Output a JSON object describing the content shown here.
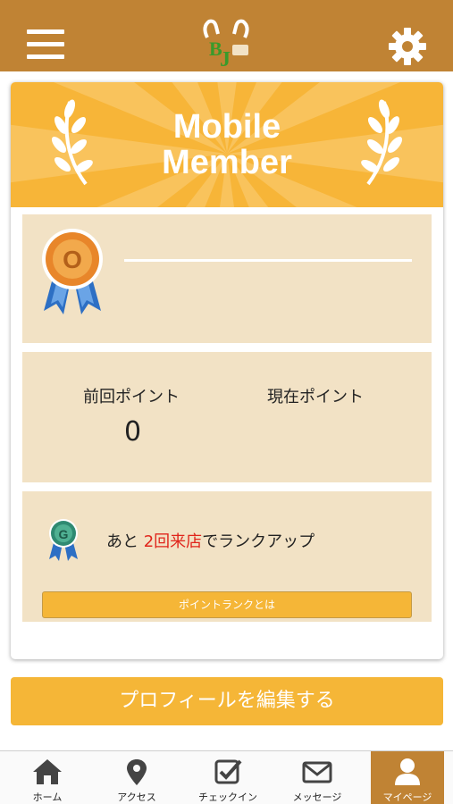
{
  "header": {
    "menu_icon": "hamburger-menu-icon",
    "logo_text": "BJ",
    "settings_icon": "gear-icon",
    "color": "#c08334"
  },
  "banner": {
    "title_line1": "Mobile",
    "title_line2": "Member",
    "color": "#f7b538"
  },
  "rank": {
    "badge_letter": "O",
    "name": ""
  },
  "points": {
    "previous_label": "前回ポイント",
    "previous_value": "0",
    "current_label": "現在ポイント",
    "current_value": ""
  },
  "next_rank": {
    "badge_letter": "G",
    "prefix": "あと ",
    "highlight": "2回来店",
    "suffix": "でランクアップ",
    "link_label": "ポイントランクとは"
  },
  "edit_profile_label": "プロフィールを編集する",
  "tabs": [
    {
      "label": "ホーム",
      "icon": "home-icon"
    },
    {
      "label": "アクセス",
      "icon": "map-pin-icon"
    },
    {
      "label": "チェックイン",
      "icon": "checkin-icon"
    },
    {
      "label": "メッセージ",
      "icon": "envelope-icon"
    },
    {
      "label": "マイページ",
      "icon": "user-icon",
      "active": true
    }
  ]
}
